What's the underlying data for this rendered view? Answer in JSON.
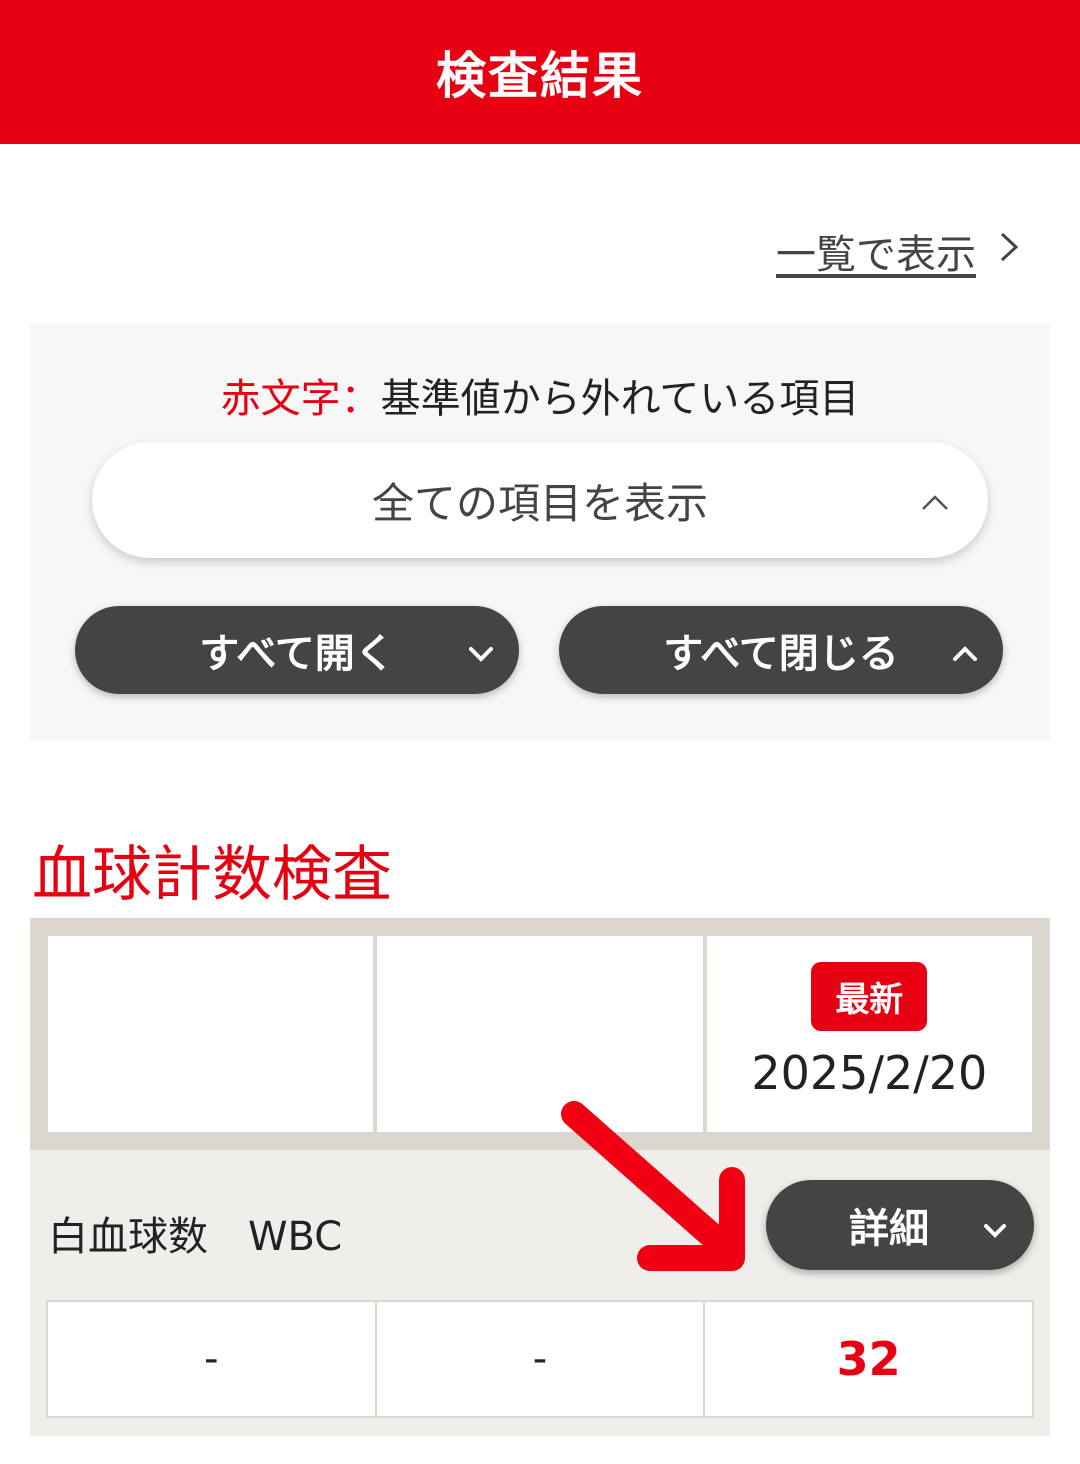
{
  "header": {
    "title": "検査結果"
  },
  "list_view_link": {
    "label": "一覧で表示",
    "chevron": "›"
  },
  "filter": {
    "legend_red": "赤文字：",
    "legend_text": "基準値から外れている項目",
    "select_value": "全ての項目を表示",
    "expand_all_label": "すべて開く",
    "collapse_all_label": "すべて閉じる"
  },
  "section": {
    "title": "血球計数検査",
    "latest_badge": "最新",
    "dates": [
      "",
      "",
      "2025/2/20"
    ],
    "item": {
      "label": "白血球数　WBC",
      "detail_label": "詳細",
      "values": [
        "-",
        "-",
        "32"
      ]
    }
  },
  "colors": {
    "accent": "#e60012",
    "button_dark": "#444444"
  },
  "icons": {
    "chevron_right": "chevron-right-icon",
    "chevron_up": "chevron-up-icon",
    "chevron_down": "chevron-down-icon"
  }
}
